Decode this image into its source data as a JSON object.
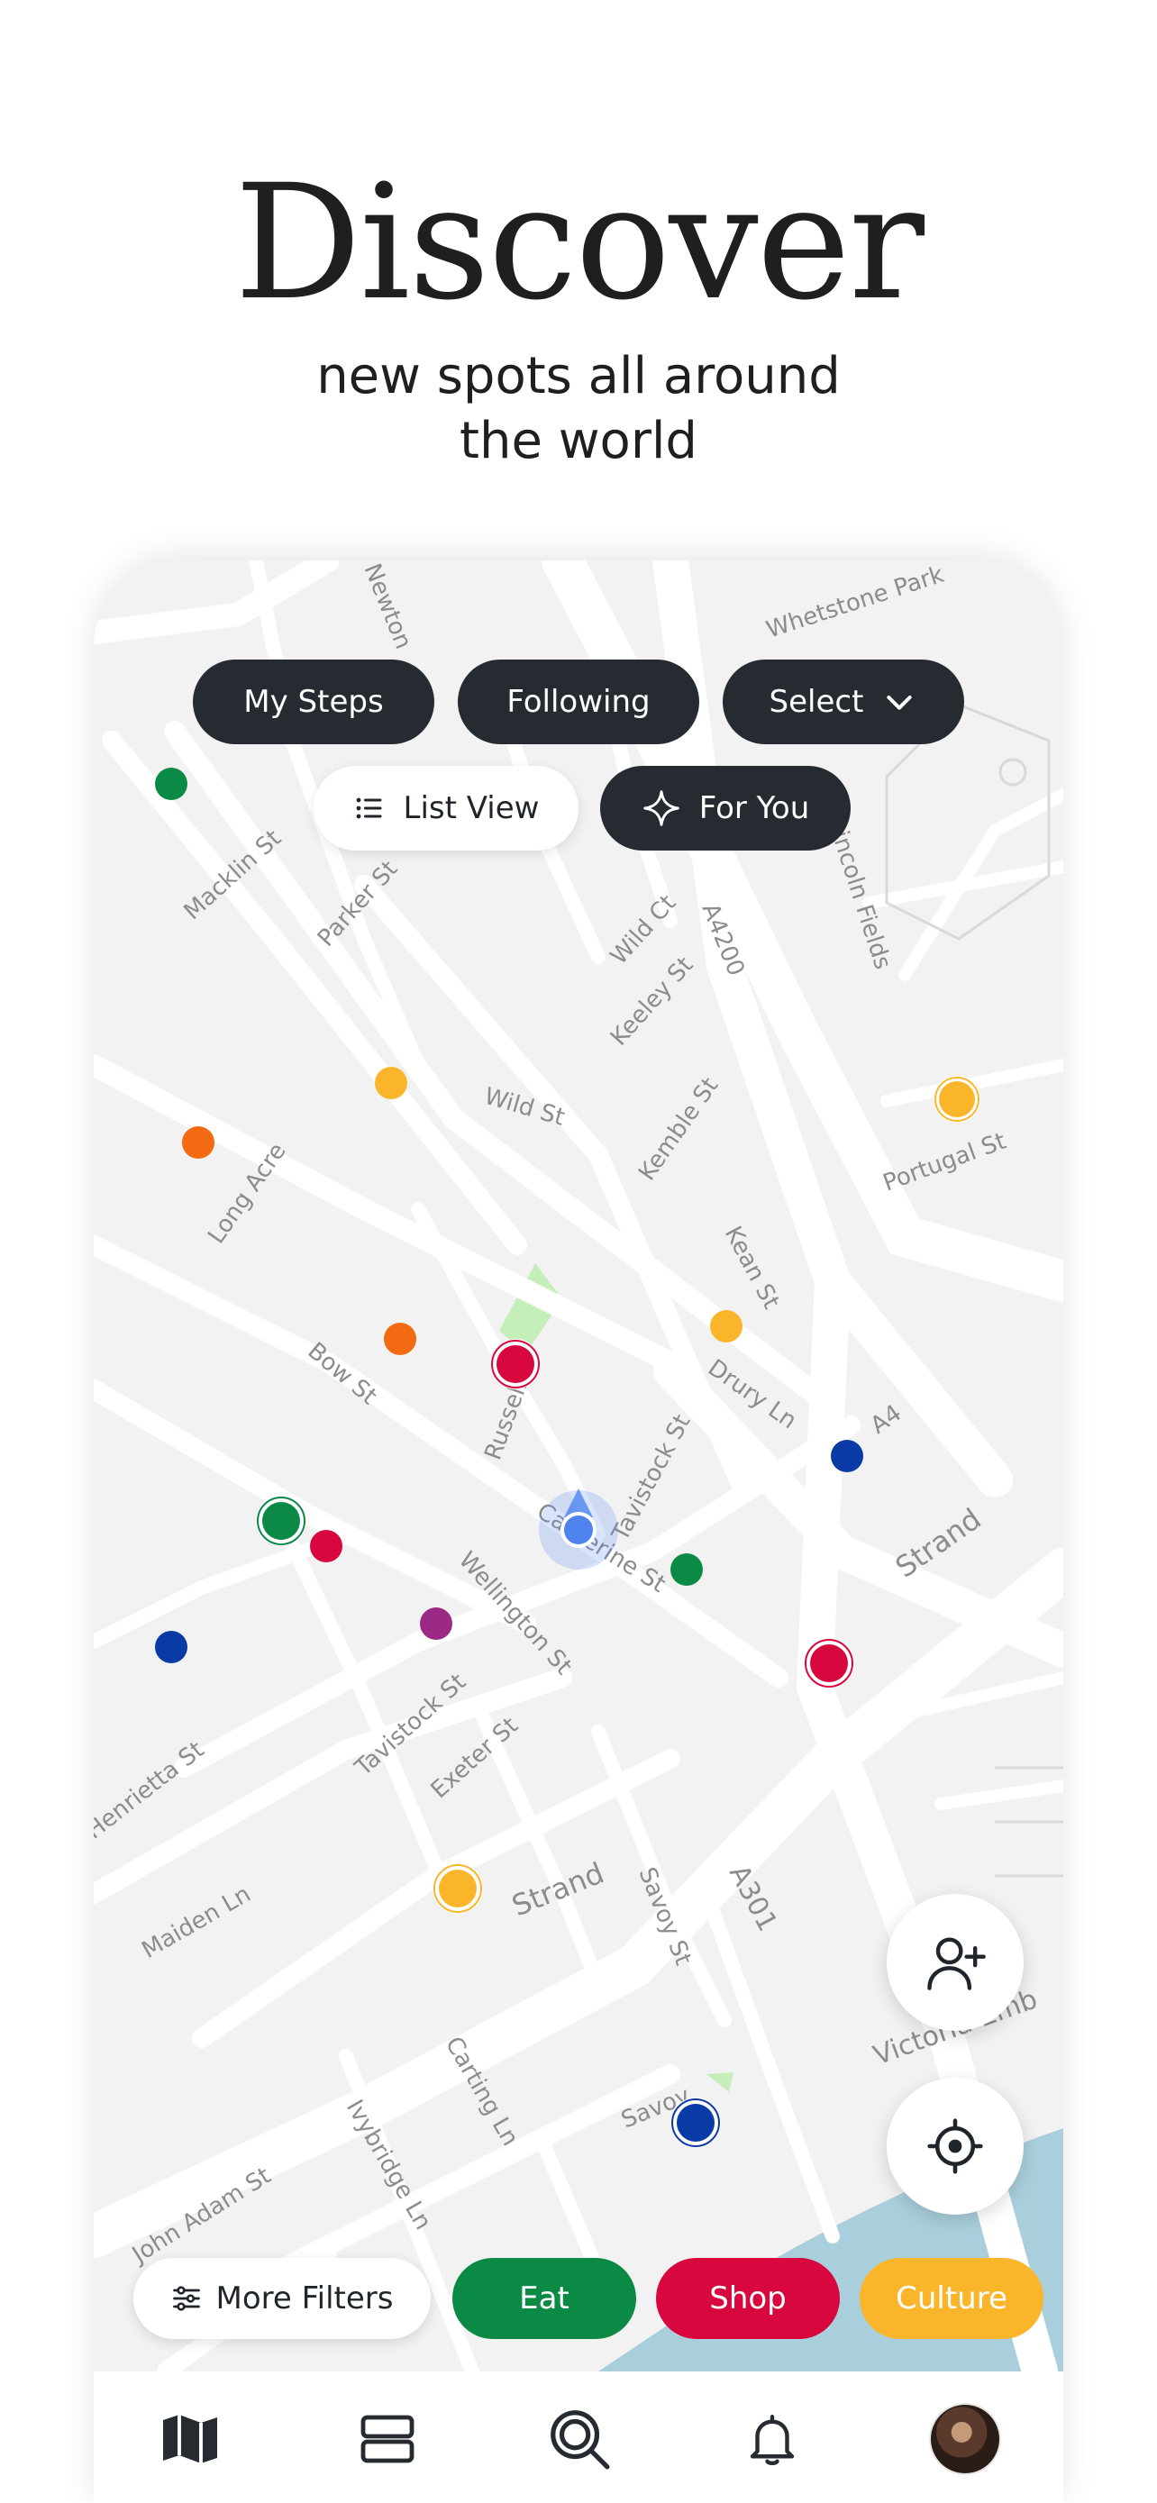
{
  "hero": {
    "title": "Discover",
    "subtitle_line1": "new spots all around",
    "subtitle_line2": "the world"
  },
  "map": {
    "street_labels": [
      "Whetstone Park",
      "Newton",
      "Macklin St",
      "Parker St",
      "Wild Ct",
      "Keeley St",
      "A4200",
      "Wild St",
      "Kemble St",
      "Portugal St",
      "Long Acre",
      "Bow St",
      "Russell",
      "Kean St",
      "Drury Ln",
      "A4",
      "Tavistock St",
      "Catherine St",
      "Strand",
      "Wellington St",
      "Tavistock St",
      "Exeter St",
      "Henrietta St",
      "Maiden Ln",
      "Strand",
      "Savoy St",
      "A301",
      "Carting Ln",
      "Savoy",
      "Ivybridge Ln",
      "John Adam St",
      "Victoria Emb",
      "Lincoln Fields"
    ]
  },
  "top_filters": {
    "my_steps": "My Steps",
    "following": "Following",
    "select": "Select",
    "list_view": "List View",
    "for_you": "For You"
  },
  "category_filters": {
    "more_filters": "More Filters",
    "eat": "Eat",
    "shop": "Shop",
    "culture": "Culture"
  },
  "colors": {
    "eat": "#0a8a44",
    "shop": "#d8073d",
    "culture": "#fbb52b",
    "dark_chip": "#262b31",
    "orange": "#f36a12",
    "blue": "#0a3aa6",
    "purple": "#9b2a84",
    "user_location": "#4f84ef",
    "water": "#aacfdc"
  },
  "icons": {
    "chevron": "chevron-down-icon",
    "list": "list-icon",
    "sparkle": "sparkle-icon",
    "sliders": "sliders-icon",
    "add_person": "add-person-icon",
    "locate": "crosshair-icon",
    "tabs": [
      "map-icon",
      "feed-icon",
      "search-icon",
      "bell-icon",
      "avatar"
    ]
  }
}
